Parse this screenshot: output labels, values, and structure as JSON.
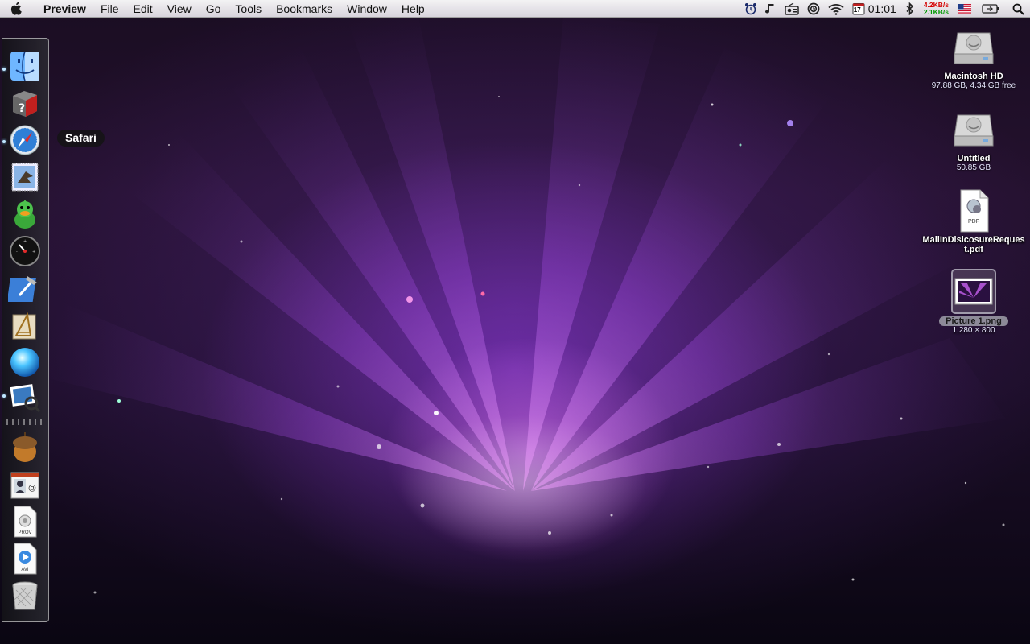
{
  "menubar": {
    "app_name": "Preview",
    "items": [
      "File",
      "Edit",
      "View",
      "Go",
      "Tools",
      "Bookmarks",
      "Window",
      "Help"
    ],
    "clock": "01:01",
    "calendar_day": "17",
    "net_down": "4.2KB/s",
    "net_up": "2.1KB/s",
    "icons": [
      "apple-icon",
      "alarm-clock-icon",
      "music-note-icon",
      "radio-icon",
      "time-machine-icon",
      "wifi-icon",
      "calendar-icon",
      "bluetooth-icon",
      "us-flag-icon",
      "battery-icon",
      "spotlight-icon"
    ]
  },
  "dock": {
    "tooltip": "Safari",
    "items": [
      {
        "name": "Finder",
        "icon": "finder-icon"
      },
      {
        "name": "Help",
        "icon": "help-icon"
      },
      {
        "name": "Safari",
        "icon": "safari-icon"
      },
      {
        "name": "Mail",
        "icon": "mail-icon"
      },
      {
        "name": "Adium",
        "icon": "adium-icon"
      },
      {
        "name": "Dashboard",
        "icon": "dashboard-icon"
      },
      {
        "name": "Xcode",
        "icon": "xcode-icon"
      },
      {
        "name": "Interface Builder",
        "icon": "interface-builder-icon"
      },
      {
        "name": "Blue Orb",
        "icon": "blue-orb-icon"
      },
      {
        "name": "Preview",
        "icon": "preview-icon"
      },
      {
        "name": "Acorn",
        "icon": "acorn-icon"
      },
      {
        "name": "Address Book",
        "icon": "address-book-icon"
      },
      {
        "name": "PROV",
        "icon": "prov-file-icon"
      },
      {
        "name": "AVI",
        "icon": "avi-file-icon"
      },
      {
        "name": "Trash",
        "icon": "trash-icon"
      }
    ],
    "file_labels": {
      "prov": "PROV",
      "avi": "AVI"
    }
  },
  "desktop": {
    "icons": [
      {
        "name": "Macintosh HD",
        "info": "97.88 GB, 4.34 GB free",
        "icon": "hard-drive-icon"
      },
      {
        "name": "Untitled",
        "info": "50.85 GB",
        "icon": "hard-drive-icon"
      },
      {
        "name": "MailInDislcosureRequest.pdf",
        "info": "",
        "icon": "pdf-file-icon",
        "badge": "PDF"
      },
      {
        "name": "Picture 1.png",
        "info": "1,280 × 800",
        "icon": "png-file-icon",
        "selected": true
      }
    ]
  },
  "colors": {
    "wallpaper_glow": "#b04cf0",
    "menubar_bg": "#eeeaf0",
    "net_down": "#d40000",
    "net_up": "#009a00"
  }
}
